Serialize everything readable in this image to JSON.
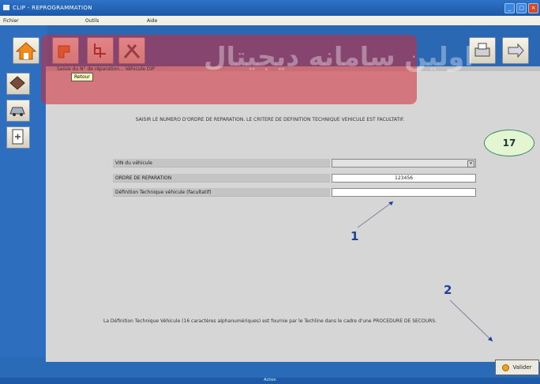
{
  "window": {
    "title": "CLIP - REPROGRAMMATION"
  },
  "menubar": {
    "fichier": "Fichier",
    "outils": "Outils",
    "aide": "Aide"
  },
  "watermark": "اولین سامانه دیجیتال",
  "breadcrumb": "Saisie du N° de réparation... Véhicule OIP",
  "retour_label": "Retour",
  "instruction": "SAISIR LE NUMERO D'ORDRE DE REPARATION. LE CRITERE DE DEFINITION TECHNIQUE VEHICULE EST FACULTATIF.",
  "badge": "17",
  "form": {
    "vin_label": "VIN du véhicule",
    "vin_value": "",
    "order_label": "ORDRE DE REPARATION",
    "order_value": "123456",
    "def_label": "Définition Technique véhicule (facultatif)",
    "def_value": ""
  },
  "annotations": {
    "one": "1",
    "two": "2"
  },
  "bottom_text": "La Définition Technique Véhicule (16 caractères alphanumériques) est fournie par le Techline dans le cadre d'une PROCEDURE DE SECOURS.",
  "validate_label": "Valider",
  "status": "Action"
}
